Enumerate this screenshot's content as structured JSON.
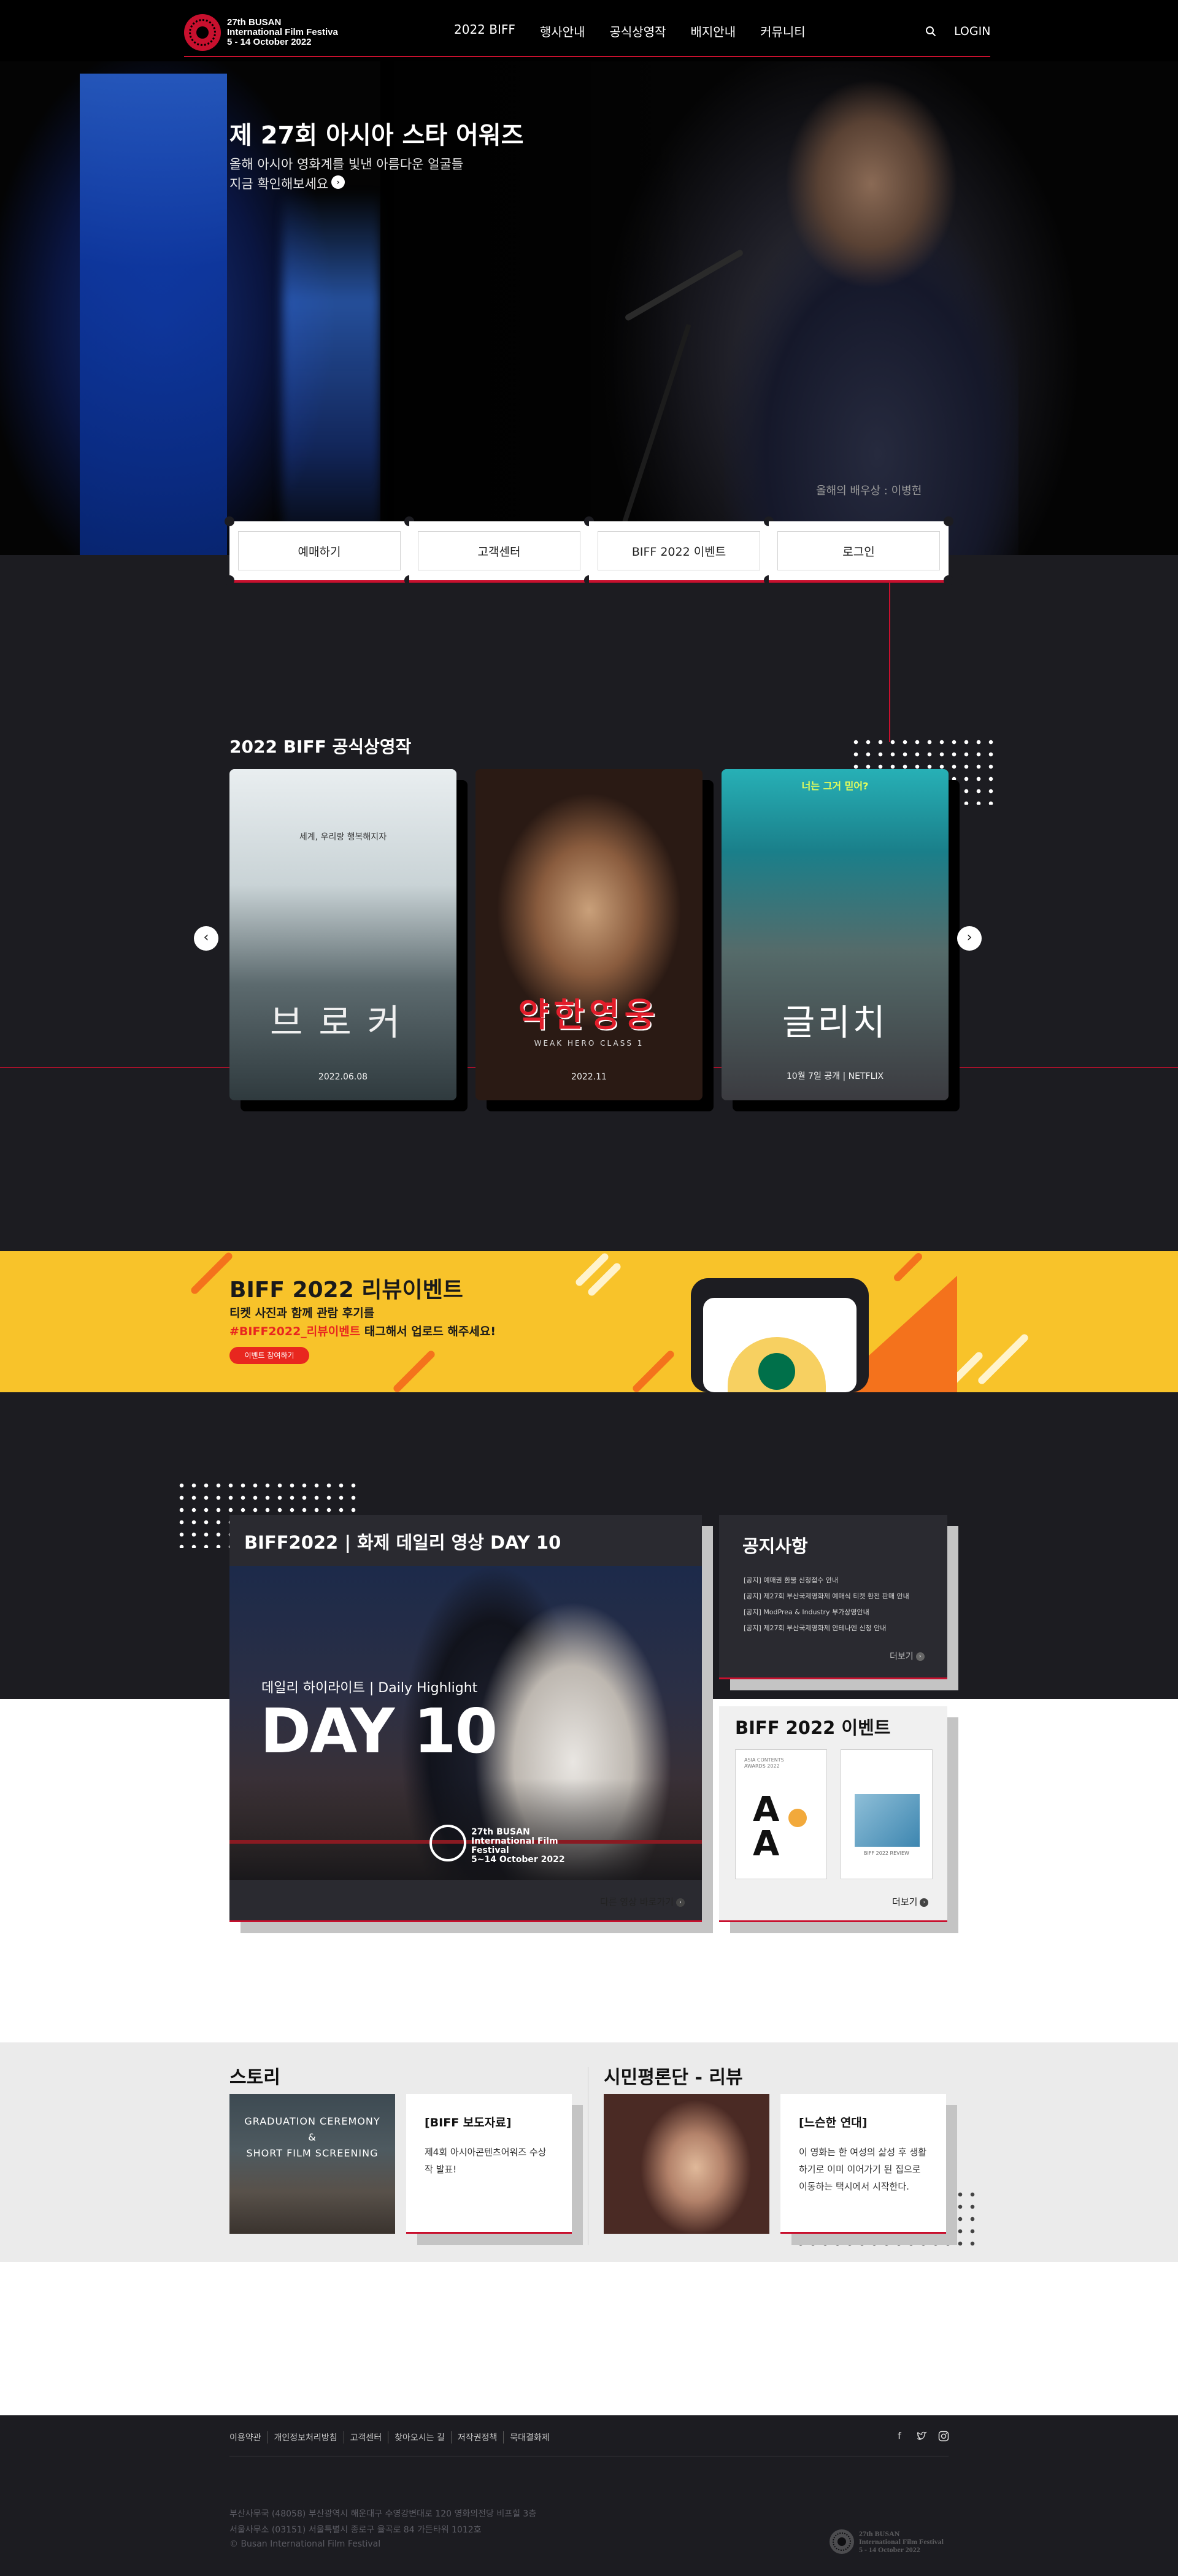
{
  "header": {
    "logo_line1": "27th BUSAN",
    "logo_line2": "International Film Festiva",
    "logo_line3": "5 - 14 October 2022",
    "nav": [
      "2022 BIFF",
      "행사안내",
      "공식상영작",
      "배지안내",
      "커뮤니티"
    ],
    "search_icon": "search-icon",
    "login": "LOGIN"
  },
  "hero": {
    "title": "제 27회 아시아 스타 어워즈",
    "subtitle_line1": "올해 아시아 영화계를 빛낸 아름다운 얼굴들",
    "subtitle_line2": "지금 확인해보세요",
    "arrow": "›",
    "caption": "올해의 배우상 : 이병헌"
  },
  "quick_links": [
    "예매하기",
    "고객센터",
    "BIFF 2022 이벤트",
    "로그인"
  ],
  "films": {
    "title": "2022 BIFF 공식상영작",
    "prev": "‹",
    "next": "›",
    "posters": [
      {
        "title": "브로커",
        "tagline": "세계, 우리랑 행복해지자",
        "date": "2022.06.08"
      },
      {
        "title": "약한영웅",
        "tagline": "WEAK HERO CLASS 1",
        "date": "2022.11"
      },
      {
        "title": "글리치",
        "tagline": "너는 그거 믿어?",
        "date": "10월 7일 공개 | NETFLIX"
      }
    ]
  },
  "banner": {
    "title": "BIFF 2022 리뷰이벤트",
    "line1": "티켓 사진과 함께 관람 후기를",
    "hashtag": "#BIFF2022_리뷰이벤트",
    "line2_rest": " 태그해서 업로드 해주세요!",
    "button": "이벤트 참여하기"
  },
  "video": {
    "title": "BIFF2022 | 화제 데일리 영상 DAY 10",
    "highlight": "데일리 하이라이트 | Daily Highlight",
    "day": "DAY 10",
    "watermark_line1": "27th BUSAN",
    "watermark_line2": "International Film Festival",
    "watermark_line3": "5~14 October 2022",
    "more": "다른 영상 바로가기"
  },
  "notice": {
    "title": "공지사항",
    "items": [
      "[공지]  예매권 환불 신청접수 안내",
      "[공지]  제27회 부산국제영화제 예매식 티켓 환전 판매 안내",
      "[공지]  ModPrea & Industry 부가상영안내",
      "[공지]  제27회 부산국제영화제 안테나엔 신청 안내"
    ],
    "more": "더보기"
  },
  "events": {
    "title": "BIFF 2022 이벤트",
    "thumb1_text": "ASIA CONTENTS AWARDS 2022",
    "thumb2_text": "BIFF 2022 REVIEW",
    "more": "더보기"
  },
  "story": {
    "title": "스토리",
    "image_text_line1": "GRADUATION CEREMONY",
    "image_text_line2": "&",
    "image_text_line3": "SHORT FILM SCREENING",
    "card_title": "[BIFF 보도자료]",
    "card_body": "제4회 아시아콘텐츠어워즈 수상작 발표!"
  },
  "review": {
    "title": "시민평론단 - 리뷰",
    "card_title": "[느슨한 연대]",
    "card_body": "이 영화는 한 여성의 삶성 후 생활하기로 이미 이어가기 된 집으로 이동하는 택시에서 시작한다."
  },
  "footer": {
    "links": [
      "이용약관",
      "개인정보처리방침",
      "고객센터",
      "찾아오시는 길",
      "저작권정책",
      "묵대결화제"
    ],
    "social": [
      "facebook-icon",
      "twitter-icon",
      "instagram-icon"
    ],
    "info_line1": "부산사무국 (48058) 부산광역시 해운대구 수영강변대로 120 영화의전당 비프힐 3층",
    "info_line2": "서울사무소 (03151) 서울특별시 종로구 율곡로 84 가든타워 1012호",
    "copyright": "© Busan International Film Festival",
    "logo_line1": "27th BUSAN",
    "logo_line2": "International Film Festival",
    "logo_line3": "5 - 14 October 2022"
  },
  "colors": {
    "accent_red": "#c8102e",
    "banner_yellow": "#f8c32a",
    "banner_orange": "#f4721c",
    "dark_bg": "#1c1c21"
  }
}
